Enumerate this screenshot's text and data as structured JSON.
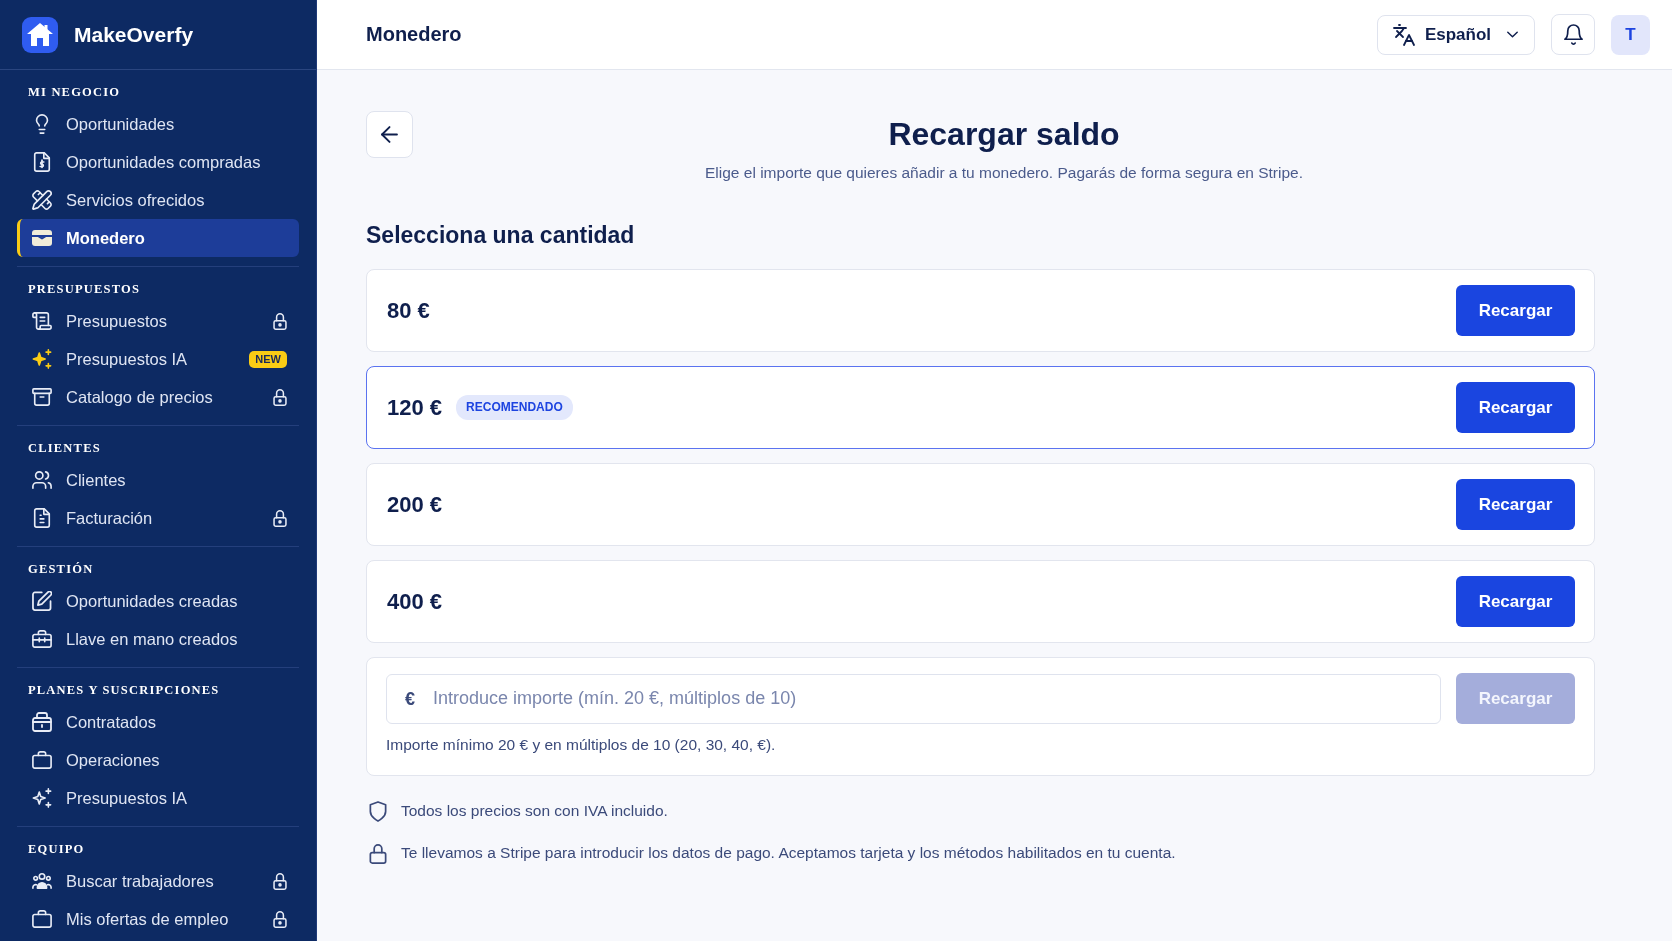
{
  "brand": {
    "name": "MakeOverfy"
  },
  "sidebar": {
    "sections": [
      {
        "title": "MI NEGOCIO",
        "items": [
          {
            "label": "Oportunidades",
            "selected": false,
            "locked": false
          },
          {
            "label": "Oportunidades compradas",
            "selected": false,
            "locked": false
          },
          {
            "label": "Servicios ofrecidos",
            "selected": false,
            "locked": false
          },
          {
            "label": "Monedero",
            "selected": true,
            "locked": false
          }
        ]
      },
      {
        "title": "PRESUPUESTOS",
        "items": [
          {
            "label": "Presupuestos",
            "selected": false,
            "locked": true
          },
          {
            "label": "Presupuestos IA",
            "selected": false,
            "locked": false,
            "badge": "NEW"
          },
          {
            "label": "Catalogo de precios",
            "selected": false,
            "locked": true
          }
        ]
      },
      {
        "title": "CLIENTES",
        "items": [
          {
            "label": "Clientes",
            "selected": false,
            "locked": false
          },
          {
            "label": "Facturación",
            "selected": false,
            "locked": true
          }
        ]
      },
      {
        "title": "GESTIÓN",
        "items": [
          {
            "label": "Oportunidades creadas",
            "selected": false,
            "locked": false
          },
          {
            "label": "Llave en mano creados",
            "selected": false,
            "locked": false
          }
        ]
      },
      {
        "title": "PLANES Y SUSCRIPCIONES",
        "items": [
          {
            "label": "Contratados",
            "selected": false,
            "locked": false
          },
          {
            "label": "Operaciones",
            "selected": false,
            "locked": false
          },
          {
            "label": "Presupuestos IA",
            "selected": false,
            "locked": false
          }
        ]
      },
      {
        "title": "EQUIPO",
        "items": [
          {
            "label": "Buscar trabajadores",
            "selected": false,
            "locked": true
          },
          {
            "label": "Mis ofertas de empleo",
            "selected": false,
            "locked": true
          }
        ]
      }
    ]
  },
  "header": {
    "title": "Monedero",
    "language": "Español",
    "avatar_initial": "T"
  },
  "recharge": {
    "title": "Recargar saldo",
    "subtitle": "Elige el importe que quieres añadir a tu monedero. Pagarás de forma segura en Stripe.",
    "section_title": "Selecciona una cantidad",
    "options": [
      {
        "amount": "80 €",
        "selected": false,
        "button": "Recargar"
      },
      {
        "amount": "120 €",
        "badge": "RECOMENDADO",
        "selected": true,
        "button": "Recargar"
      },
      {
        "amount": "200 €",
        "selected": false,
        "button": "Recargar"
      },
      {
        "amount": "400 €",
        "selected": false,
        "button": "Recargar"
      }
    ],
    "custom": {
      "currency": "€",
      "placeholder": "Introduce importe (mín. 20 €, múltiplos de 10)",
      "button": {
        "label": "Recargar",
        "disabled": true
      },
      "hint": "Importe mínimo 20 € y en múltiplos de 10 (20, 30, 40, €)."
    },
    "notes": [
      "Todos los precios son con IVA incluido.",
      "Te llevamos a Stripe para introducir los datos de pago. Aceptamos tarjeta y los métodos habilitados en tu cuenta."
    ]
  }
}
